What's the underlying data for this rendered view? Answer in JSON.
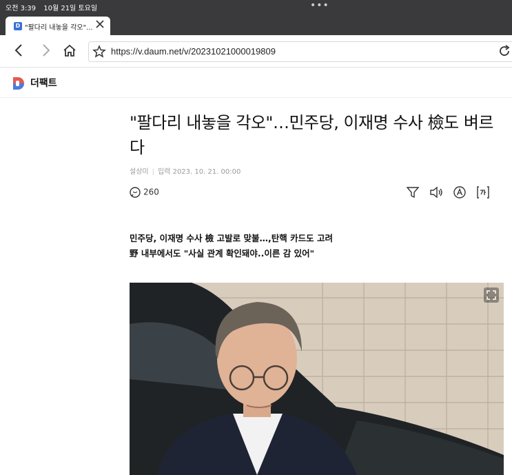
{
  "status_bar": {
    "time": "오전 3:39",
    "date": "10월 21일 토요일"
  },
  "browser": {
    "tab": {
      "title": "\"팔다리 내놓을 각오\"...",
      "favicon": "D"
    },
    "url": "https://v.daum.net/v/20231021000019809"
  },
  "site": {
    "name": "더팩트"
  },
  "article": {
    "headline": "\"팔다리 내놓을 각오\"…민주당, 이재명 수사 檢도 벼르다",
    "author": "설상미",
    "date_label": "입력",
    "date": "2023. 10. 21. 00:00",
    "comment_count": "260",
    "subheads": [
      "민주당, 이재명 수사 檢 고발로 맞불…,탄핵 카드도 고려",
      "野 내부에서도 \"사실 관계 확인돼야..이른 감 있어\""
    ]
  },
  "icons": [
    "back-icon",
    "forward-icon",
    "home-icon",
    "bookmark-star-icon",
    "reload-icon",
    "comment-icon",
    "summary-icon",
    "listen-icon",
    "translate-icon",
    "font-size-icon",
    "expand-icon"
  ],
  "colors": {
    "accent": "#3b6fd8",
    "topbar": "#3a3a3d"
  }
}
